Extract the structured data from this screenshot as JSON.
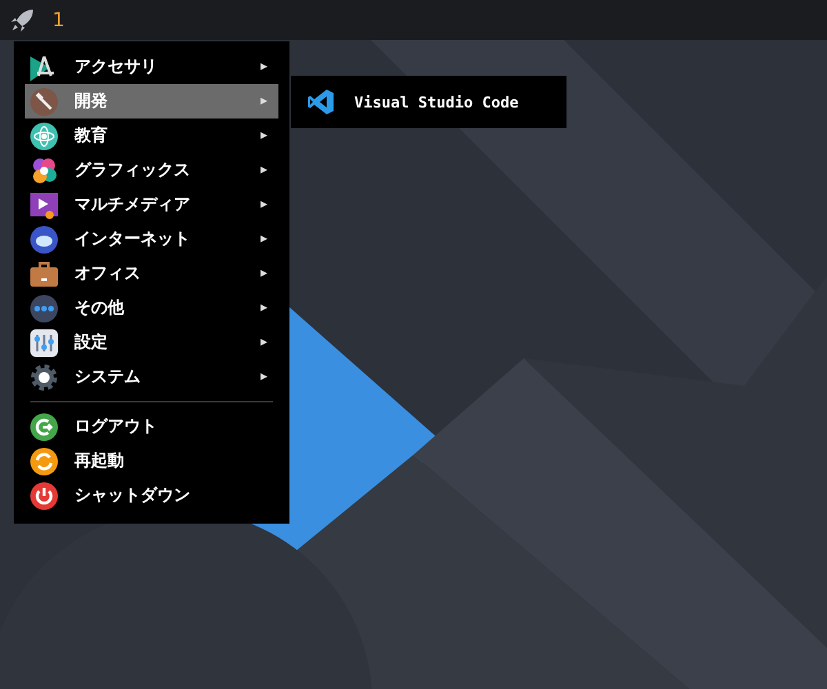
{
  "top_bar": {
    "workspace": "1"
  },
  "menu": {
    "sections": [
      {
        "items": [
          {
            "label": "アクセサリ",
            "arrow": "▸",
            "selected": false
          },
          {
            "label": "開発",
            "arrow": "▸",
            "selected": true
          },
          {
            "label": "教育",
            "arrow": "▸",
            "selected": false
          },
          {
            "label": "グラフィックス",
            "arrow": "▸",
            "selected": false
          },
          {
            "label": "マルチメディア",
            "arrow": "▸",
            "selected": false
          },
          {
            "label": "インターネット",
            "arrow": "▸",
            "selected": false
          },
          {
            "label": "オフィス",
            "arrow": "▸",
            "selected": false
          },
          {
            "label": "その他",
            "arrow": "▸",
            "selected": false
          },
          {
            "label": "設定",
            "arrow": "▸",
            "selected": false
          },
          {
            "label": "システム",
            "arrow": "▸",
            "selected": false
          }
        ]
      },
      {
        "items": [
          {
            "label": "ログアウト",
            "selected": false
          },
          {
            "label": "再起動",
            "selected": false
          },
          {
            "label": "シャットダウン",
            "selected": false
          }
        ]
      }
    ]
  },
  "submenu": {
    "items": [
      {
        "label": "Visual Studio Code"
      }
    ]
  }
}
